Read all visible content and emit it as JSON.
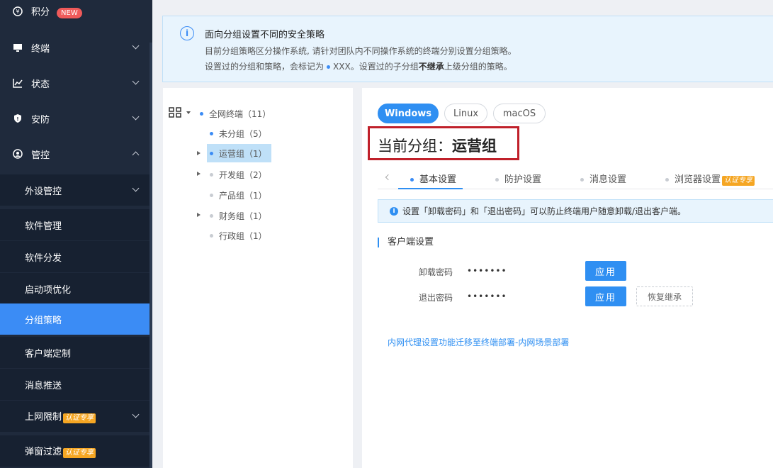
{
  "sidebar": {
    "top_items": [
      {
        "label": "积分",
        "icon": "coin-icon",
        "badge": "NEW"
      },
      {
        "label": "终端",
        "icon": "monitor-icon"
      },
      {
        "label": "状态",
        "icon": "chart-line-icon"
      },
      {
        "label": "安防",
        "icon": "shield-icon"
      },
      {
        "label": "管控",
        "icon": "control-icon"
      }
    ],
    "sub_items": [
      {
        "label": "外设管控"
      },
      {
        "label": "软件管理"
      },
      {
        "label": "软件分发"
      },
      {
        "label": "启动项优化"
      },
      {
        "label": "分组策略"
      },
      {
        "label": "客户端定制"
      },
      {
        "label": "消息推送"
      },
      {
        "label": "上网限制",
        "badge": "认证专享"
      },
      {
        "label": "弹窗过滤",
        "badge": "认证专享"
      }
    ]
  },
  "banner": {
    "title": "面向分组设置不同的安全策略",
    "line1": "目前分组策略区分操作系统, 请针对团队内不同操作系统的终端分别设置分组策略。",
    "line2_a": "设置过的分组和策略，会标记为",
    "line2_b": "XXX",
    "line2_c": "。设置过的子分组",
    "line2_bold": "不继承",
    "line2_d": "上级分组的策略。"
  },
  "tree": {
    "root": "全网终端（11）",
    "nodes": [
      {
        "label": "未分组（5）"
      },
      {
        "label": "运营组（1）"
      },
      {
        "label": "开发组（2）"
      },
      {
        "label": "产品组（1）"
      },
      {
        "label": "财务组（1）"
      },
      {
        "label": "行政组（1）"
      }
    ]
  },
  "os_tabs": [
    "Windows",
    "Linux",
    "macOS"
  ],
  "current_group": {
    "prefix": "当前分组：",
    "name": "运营组"
  },
  "sub_tabs": [
    {
      "label": "基本设置"
    },
    {
      "label": "防护设置"
    },
    {
      "label": "消息设置"
    },
    {
      "label": "浏览器设置",
      "badge": "认证专享"
    }
  ],
  "tip": "设置「卸载密码」和「退出密码」可以防止终端用户随意卸载/退出客户端。",
  "section_title": "客户端设置",
  "form": {
    "uninstall_label": "卸载密码",
    "uninstall_value": "•••••••",
    "exit_label": "退出密码",
    "exit_value": "•••••••",
    "apply": "应用",
    "restore": "恢复继承"
  },
  "link": "内网代理设置功能迁移至终端部署-内网场景部署",
  "colors": {
    "accent": "#2f8ff2",
    "sidebar_bg": "#1f2a3c",
    "active_item": "#3b8cf5",
    "highlight_box": "#c0202a"
  }
}
